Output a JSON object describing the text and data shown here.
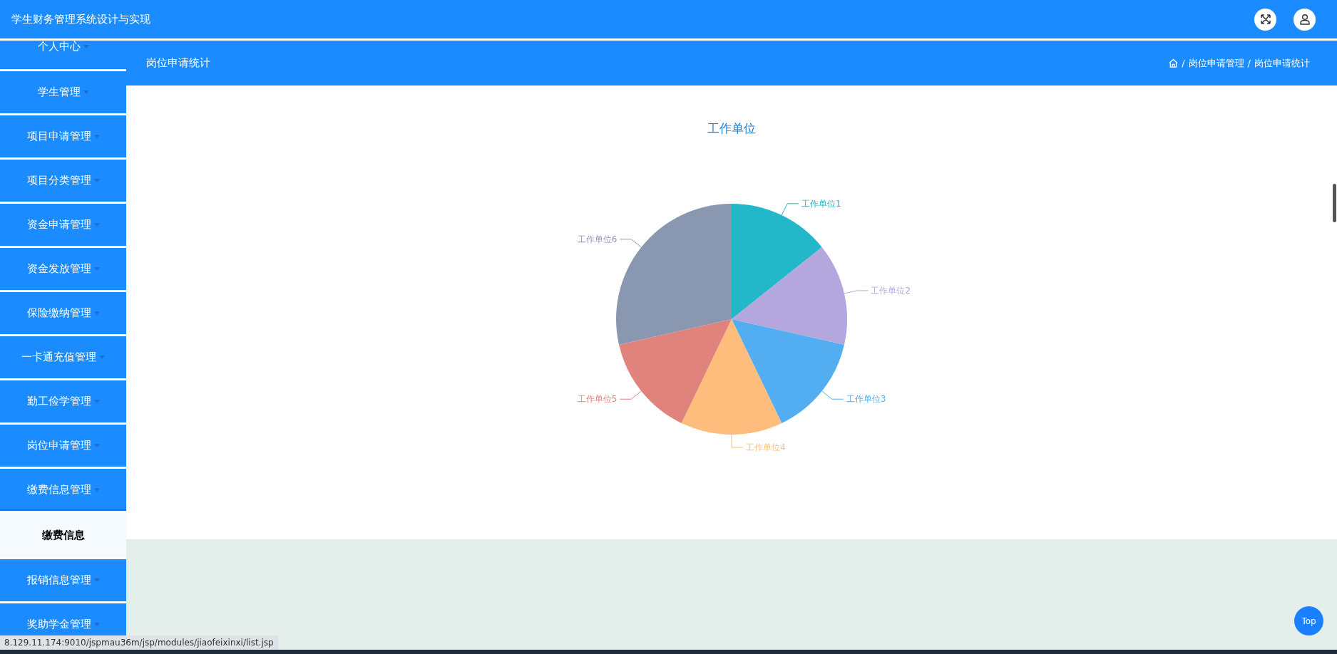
{
  "header": {
    "title": "学生财务管理系统设计与实现"
  },
  "sidebar": {
    "items": [
      {
        "label": "个人中心",
        "expanded": false
      },
      {
        "label": "学生管理",
        "expanded": false
      },
      {
        "label": "项目申请管理",
        "expanded": false
      },
      {
        "label": "项目分类管理",
        "expanded": false
      },
      {
        "label": "资金申请管理",
        "expanded": false
      },
      {
        "label": "资金发放管理",
        "expanded": false
      },
      {
        "label": "保险缴纳管理",
        "expanded": false
      },
      {
        "label": "一卡通充值管理",
        "expanded": false
      },
      {
        "label": "勤工俭学管理",
        "expanded": false
      },
      {
        "label": "岗位申请管理",
        "expanded": false
      },
      {
        "label": "缴费信息管理",
        "expanded": true,
        "children": [
          {
            "label": "缴费信息",
            "selected": true
          }
        ]
      },
      {
        "label": "报销信息管理",
        "expanded": false
      },
      {
        "label": "奖助学金管理",
        "expanded": false
      }
    ]
  },
  "page_header": {
    "title": "岗位申请统计",
    "breadcrumb": {
      "separator": "/",
      "items": [
        "岗位申请管理",
        "岗位申请统计"
      ]
    }
  },
  "chart_data": {
    "type": "pie",
    "title": "工作单位",
    "categories": [
      "工作单位1",
      "工作单位2",
      "工作单位3",
      "工作单位4",
      "工作单位5",
      "工作单位6"
    ],
    "values": [
      1,
      1,
      1,
      1,
      1,
      2
    ],
    "colors": [
      "#22b7c9",
      "#b4a7de",
      "#52adf1",
      "#ffbd7d",
      "#df837c",
      "#8a97b0"
    ]
  },
  "back_to_top": "Top",
  "status_url": "8.129.11.174:9010/jspmau36m/jsp/modules/jiaofeixinxi/list.jsp"
}
